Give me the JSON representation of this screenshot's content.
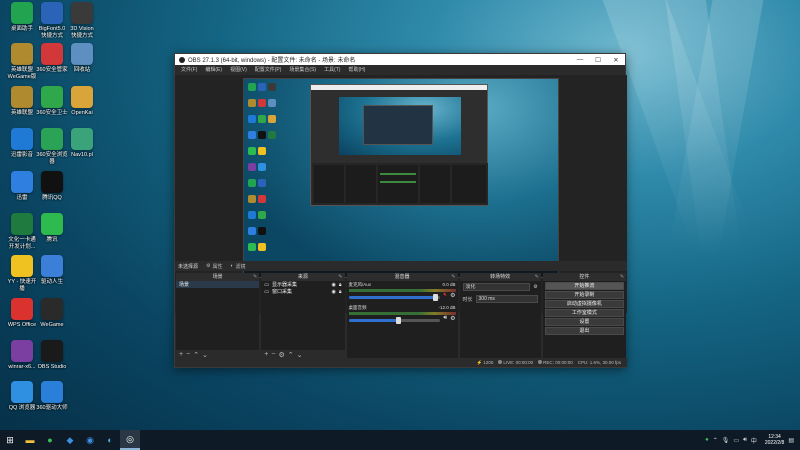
{
  "desktop": {
    "icons": [
      {
        "label": "桌面助手",
        "icon": "desktop-helper-icon",
        "color": "#22a34f"
      },
      {
        "label": "BigFont5.0\n快捷方式",
        "icon": "bigfont-icon",
        "color": "#2b63b8"
      },
      {
        "label": "3D Vision\n快捷方式",
        "icon": "nvidia-3d-vision-icon",
        "color": "#3a3a3a"
      },
      {
        "label": "英雄联盟\nWeGame版",
        "icon": "league-of-legends-icon",
        "color": "#b08a2e"
      },
      {
        "label": "360安全管家",
        "icon": "360-manager-icon",
        "color": "#d2373a"
      },
      {
        "label": "回收站",
        "icon": "recycle-bin-icon",
        "color": "#5d8fc0"
      },
      {
        "label": "英雄联盟",
        "icon": "league-icon",
        "color": "#b08a2e"
      },
      {
        "label": "360安全卫士",
        "icon": "360-security-icon",
        "color": "#2ea84a"
      },
      {
        "label": "OpenKai",
        "icon": "folder-icon",
        "color": "#d9a53a"
      },
      {
        "label": "迅雷影音",
        "icon": "xunlei-player-icon",
        "color": "#1f7ad6"
      },
      {
        "label": "360安全浏览\n器",
        "icon": "360-browser-icon",
        "color": "#2aa356"
      },
      {
        "label": "Nav10.pl",
        "icon": "nav-app-icon",
        "color": "#3aa37a"
      },
      {
        "label": "迅雷",
        "icon": "xunlei-icon",
        "color": "#2f7fe0"
      },
      {
        "label": "腾讯QQ",
        "icon": "qq-icon",
        "color": "#111"
      },
      {
        "label": "文化一卡通\n开发计划...",
        "icon": "excel-file-icon",
        "color": "#1f7a3f"
      },
      {
        "label": "腾讯",
        "icon": "wechat-icon",
        "color": "#2dbb4f"
      },
      {
        "label": "YY - 快速开\n播",
        "icon": "yy-icon",
        "color": "#f0c221"
      },
      {
        "label": "驱动人生",
        "icon": "driver-life-icon",
        "color": "#3c7fd8"
      },
      {
        "label": "WPS Office",
        "icon": "wps-icon",
        "color": "#d9322f"
      },
      {
        "label": "WeGame",
        "icon": "wegame-icon",
        "color": "#2a2a2a"
      },
      {
        "label": "winrar-x6...",
        "icon": "winrar-icon",
        "color": "#7a3fa0"
      },
      {
        "label": "OBS Studio",
        "icon": "obs-icon",
        "color": "#1a1a1a"
      },
      {
        "label": "QQ 浏览器",
        "icon": "qq-browser-icon",
        "color": "#2f8fe0"
      },
      {
        "label": "360驱动大师",
        "icon": "360-driver-icon",
        "color": "#2a7fd8"
      }
    ]
  },
  "obs": {
    "title": "OBS 27.1.3 (64-bit, windows) - 配置文件: 未命名 - 场景: 未命名",
    "window_buttons": {
      "minimize": "—",
      "maximize": "☐",
      "close": "✕"
    },
    "menu": [
      "文件(F)",
      "编辑(E)",
      "视图(V)",
      "配置文件(P)",
      "场景集合(S)",
      "工具(T)",
      "帮助(H)"
    ],
    "status_row": {
      "selected": "未选择源",
      "properties": "属性",
      "filters": "滤镜"
    },
    "docks": {
      "scenes": {
        "title": "场景",
        "items": [
          "场景"
        ]
      },
      "sources": {
        "title": "来源",
        "items": [
          "显示器采集",
          "窗口采集"
        ]
      },
      "mixer": {
        "title": "混音器",
        "channels": [
          {
            "name": "麦克风/Aux",
            "db": "0.0 dB",
            "level": 0.95
          },
          {
            "name": "桌面音频",
            "db": "-12.0 dB",
            "level": 0.55
          }
        ]
      },
      "transitions": {
        "title": "转场特效",
        "type": "淡化",
        "duration_label": "时长",
        "duration": "300 ms"
      },
      "controls": {
        "title": "控件",
        "buttons": [
          "开始推流",
          "开始录制",
          "启动虚拟摄像机",
          "工作室模式",
          "设置",
          "退出"
        ]
      }
    },
    "statusbar": {
      "live_label": "LIVE:",
      "live_time": "00:00:00",
      "rec_label": "REC:",
      "rec_time": "00:00:00",
      "cpu": "CPU: 1.6%, 30.00 fps",
      "dropped": "1200"
    }
  },
  "taskbar": {
    "time": "12:34",
    "date": "2022/2/8",
    "lang": "中"
  },
  "colors": {
    "accent": "#2f6fd0",
    "desktop": "#146583",
    "obs_bg": "#2b2b2b"
  }
}
